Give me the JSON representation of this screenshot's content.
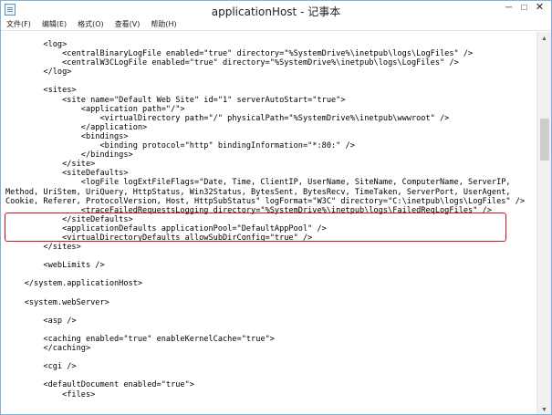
{
  "window": {
    "title": "applicationHost - 记事本",
    "icon": "notepad-icon",
    "controls": {
      "minimize": "─",
      "maximize": "□",
      "close": "✕"
    }
  },
  "menu": {
    "items": [
      {
        "label": "文件(F)"
      },
      {
        "label": "编辑(E)"
      },
      {
        "label": "格式(O)"
      },
      {
        "label": "查看(V)"
      },
      {
        "label": "帮助(H)"
      }
    ]
  },
  "editor": {
    "lines": [
      "        <log>",
      "            <centralBinaryLogFile enabled=\"true\" directory=\"%SystemDrive%\\inetpub\\logs\\LogFiles\" />",
      "            <centralW3CLogFile enabled=\"true\" directory=\"%SystemDrive%\\inetpub\\logs\\LogFiles\" />",
      "        </log>",
      "",
      "        <sites>",
      "            <site name=\"Default Web Site\" id=\"1\" serverAutoStart=\"true\">",
      "                <application path=\"/\">",
      "                    <virtualDirectory path=\"/\" physicalPath=\"%SystemDrive%\\inetpub\\wwwroot\" />",
      "                </application>",
      "                <bindings>",
      "                    <binding protocol=\"http\" bindingInformation=\"*:80:\" />",
      "                </bindings>",
      "            </site>",
      "            <siteDefaults>",
      "                <logFile logExtFileFlags=\"Date, Time, ClientIP, UserName, SiteName, ComputerName, ServerIP,",
      "Method, UriStem, UriQuery, HttpStatus, Win32Status, BytesSent, BytesRecv, TimeTaken, ServerPort, UserAgent,",
      "Cookie, Referer, ProtocolVersion, Host, HttpSubStatus\" logFormat=\"W3C\" directory=\"C:\\inetpub\\logs\\LogFiles\" />",
      "                <traceFailedRequestsLogging directory=\"%SystemDrive%\\inetpub\\logs\\FailedReqLogFiles\" />",
      "            </siteDefaults>",
      "            <applicationDefaults applicationPool=\"DefaultAppPool\" />",
      "            <virtualDirectoryDefaults allowSubDirConfig=\"true\" />",
      "        </sites>",
      "",
      "        <webLimits />",
      "",
      "    </system.applicationHost>",
      "",
      "    <system.webServer>",
      "",
      "        <asp />",
      "",
      "        <caching enabled=\"true\" enableKernelCache=\"true\">",
      "        </caching>",
      "",
      "        <cgi />",
      "",
      "        <defaultDocument enabled=\"true\">",
      "            <files>"
    ]
  },
  "annotation": {
    "highlight_color": "#d0151b"
  }
}
